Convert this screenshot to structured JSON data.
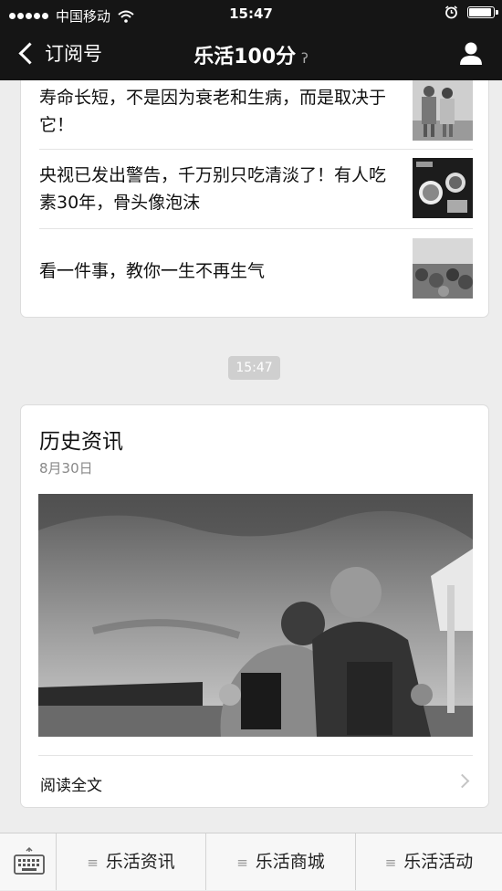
{
  "status_bar": {
    "carrier": "中国移动",
    "time": "15:47",
    "icons": [
      "signal-dots-icon",
      "wifi-icon",
      "alarm-icon",
      "battery-icon"
    ]
  },
  "nav": {
    "back_label": "订阅号",
    "title": "乐活100分",
    "icons": [
      "back-chevron-icon",
      "ear-icon",
      "person-icon"
    ]
  },
  "news": {
    "items": [
      {
        "title": "寿命长短，不是因为衰老和生病，而是取决于它！"
      },
      {
        "title": "央视已发出警告，千万别只吃清淡了！有人吃素30年，骨头像泡沫"
      },
      {
        "title": "看一件事，教你一生不再生气"
      }
    ]
  },
  "timestamp": "15:47",
  "article": {
    "title": "历史资讯",
    "date": "8月30日",
    "read_label": "阅读全文"
  },
  "bottom_menu": {
    "items": [
      {
        "label": "乐活资讯"
      },
      {
        "label": "乐活商城"
      },
      {
        "label": "乐活活动"
      }
    ],
    "icons": [
      "keyboard-icon",
      "menu-lines-icon"
    ]
  },
  "colors": {
    "header_bg": "#151515",
    "page_bg": "#ededed",
    "card_bg": "#ffffff"
  }
}
